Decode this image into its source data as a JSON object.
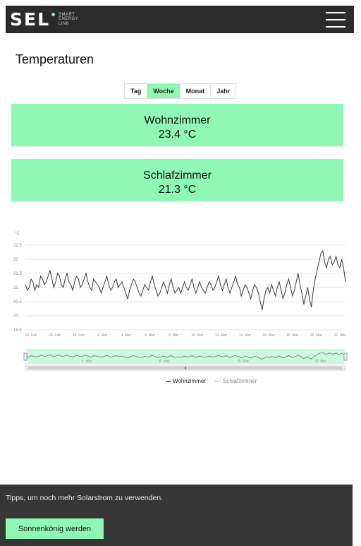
{
  "header": {
    "brand": "SEL",
    "tagline": [
      "SMART",
      "ENERGY",
      "LINK"
    ],
    "menu_icon": "hamburger-menu-icon"
  },
  "page": {
    "title": "Temperaturen"
  },
  "tabs": [
    {
      "label": "Tag",
      "active": false
    },
    {
      "label": "Woche",
      "active": true
    },
    {
      "label": "Monat",
      "active": false
    },
    {
      "label": "Jahr",
      "active": false
    }
  ],
  "cards": [
    {
      "name": "Wohnzimmer",
      "value": "23.4 °C"
    },
    {
      "name": "Schlafzimmer",
      "value": "21.3 °C"
    }
  ],
  "colors": {
    "accent": "#8ef8b4",
    "dark": "#2b2b2b",
    "footer": "#363636"
  },
  "chart_data": {
    "type": "line",
    "ylabel": "°C",
    "ylim": [
      19.5,
      22.5
    ],
    "yticks": [
      "22.5",
      "22",
      "21.5",
      "21",
      "20.5",
      "20",
      "19.5"
    ],
    "xticks": [
      "24. Feb",
      "26. Feb",
      "28. Feb",
      "2. Mar",
      "4. Mar",
      "6. Mar",
      "8. Mar",
      "10. Mar",
      "12. Mar",
      "14. Mar",
      "16. Mar",
      "18. Mar",
      "20. Mar",
      "22. Mar"
    ],
    "navigator_labels": [
      "1. Mar",
      "8. Mar",
      "15. Mar",
      "22. Mar"
    ],
    "series": [
      {
        "name": "Wohnzimmer",
        "visible": true,
        "values": [
          21.1,
          20.9,
          21.0,
          21.3,
          21.2,
          20.9,
          21.1,
          21.0,
          21.4,
          21.3,
          21.1,
          21.2,
          21.4,
          21.6,
          21.3,
          21.0,
          21.2,
          21.5,
          21.4,
          21.1,
          21.0,
          21.3,
          21.5,
          21.2,
          21.1,
          20.9,
          21.2,
          21.4,
          21.3,
          21.0,
          21.1,
          21.3,
          21.5,
          21.2,
          21.0,
          20.9,
          21.3,
          21.2,
          21.1,
          21.0,
          20.8,
          21.0,
          21.2,
          21.4,
          21.1,
          20.9,
          21.0,
          21.2,
          21.3,
          21.0,
          21.1,
          21.2,
          21.0,
          20.8,
          20.6,
          20.9,
          21.1,
          21.3,
          21.2,
          21.0,
          20.8,
          20.7,
          20.9,
          21.1,
          21.0,
          20.9,
          21.2,
          21.4,
          21.1,
          20.9,
          20.7,
          20.8,
          21.0,
          21.2,
          21.0,
          20.8,
          21.1,
          21.3,
          21.0,
          20.8,
          20.9,
          21.0,
          20.8,
          21.0,
          21.2,
          21.0,
          20.9,
          21.1,
          21.3,
          21.0,
          20.8,
          21.0,
          21.2,
          21.0,
          20.9,
          20.8,
          21.0,
          21.2,
          21.1,
          20.9,
          21.0,
          21.2,
          21.4,
          21.1,
          20.9,
          21.1,
          21.3,
          21.0,
          20.8,
          21.0,
          21.2,
          21.4,
          21.1,
          21.0,
          20.7,
          20.9,
          21.1,
          21.0,
          20.8,
          20.6,
          20.9,
          21.1,
          21.0,
          20.8,
          20.5,
          20.2,
          20.6,
          20.9,
          21.0,
          20.8,
          21.1,
          20.9,
          20.7,
          21.0,
          21.2,
          20.9,
          20.6,
          20.8,
          21.1,
          21.3,
          21.0,
          20.7,
          20.9,
          21.2,
          21.5,
          21.1,
          20.8,
          20.4,
          20.7,
          21.0,
          20.6,
          20.3,
          20.9,
          21.3,
          21.6,
          21.9,
          22.2,
          22.3,
          21.9,
          21.7,
          22.0,
          22.1,
          21.8,
          21.9,
          22.1,
          21.8,
          21.7,
          22.0,
          21.7,
          21.2
        ]
      },
      {
        "name": "Schlafzimmer",
        "visible": false,
        "values": []
      }
    ]
  },
  "legend": [
    "Wohnzimmer",
    "Schlafzimmer"
  ],
  "footer": {
    "tip": "Tipps, um noch mehr Solarstrom zu verwenden.",
    "button": "Sonnenkönig werden"
  }
}
